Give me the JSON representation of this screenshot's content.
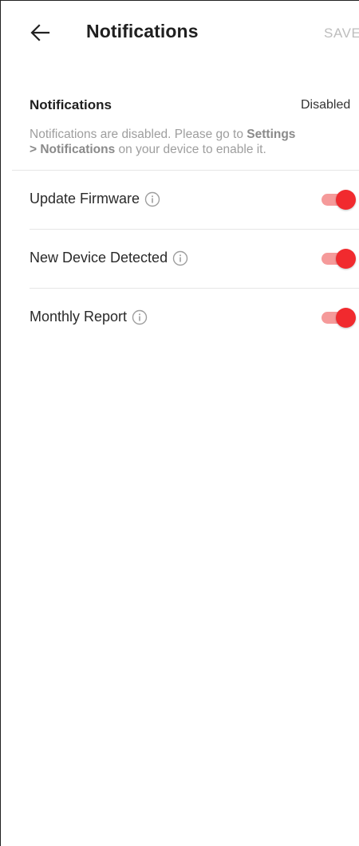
{
  "header": {
    "title": "Notifications",
    "save_label": "SAVE",
    "back_icon": "arrow-left-icon"
  },
  "status": {
    "label": "Notifications",
    "value": "Disabled",
    "description_pre": "Notifications are disabled. Please go to ",
    "description_bold1": "Settings",
    "description_bold2": "> Notifications",
    "description_post": " on your device to enable it."
  },
  "settings": [
    {
      "label": "Update Firmware",
      "enabled": true,
      "info_icon": "info-icon"
    },
    {
      "label": "New Device Detected",
      "enabled": true,
      "info_icon": "info-icon"
    },
    {
      "label": "Monthly Report",
      "enabled": true,
      "info_icon": "info-icon"
    }
  ],
  "colors": {
    "toggle_thumb": "#f12a2e",
    "toggle_track": "#f59a9a",
    "save_disabled": "#bdbdbd",
    "muted_text": "#9e9e9e"
  }
}
